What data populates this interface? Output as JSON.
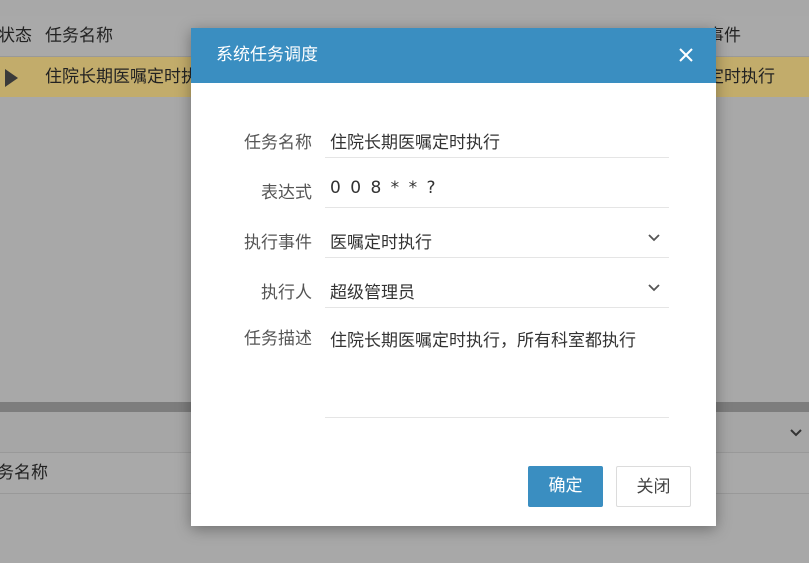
{
  "background": {
    "grid_header": {
      "col_status": "状态",
      "col_task_name": "任务名称",
      "col_event": "事件"
    },
    "selected_row": {
      "task_name": "住院长期医嘱定时执",
      "event": "定时执行"
    },
    "lower_grid_header": {
      "col_task_name": "务名称"
    }
  },
  "dialog": {
    "title": "系统任务调度",
    "fields": {
      "task_name": {
        "label": "任务名称",
        "value": "住院长期医嘱定时执行"
      },
      "expression": {
        "label": "表达式",
        "value": "0 0 8 * * ?"
      },
      "event": {
        "label": "执行事件",
        "value": "医嘱定时执行"
      },
      "executor": {
        "label": "执行人",
        "value": "超级管理员"
      },
      "description": {
        "label": "任务描述",
        "value": "住院长期医嘱定时执行，所有科室都执行"
      }
    },
    "buttons": {
      "confirm": "确定",
      "close": "关闭"
    }
  },
  "colors": {
    "accent": "#3a8ec1",
    "selected_row": "#c2ac6b"
  },
  "icons": {
    "close": "close-icon",
    "dropdown": "chevron-down-icon",
    "row_indicator": "play-icon"
  }
}
